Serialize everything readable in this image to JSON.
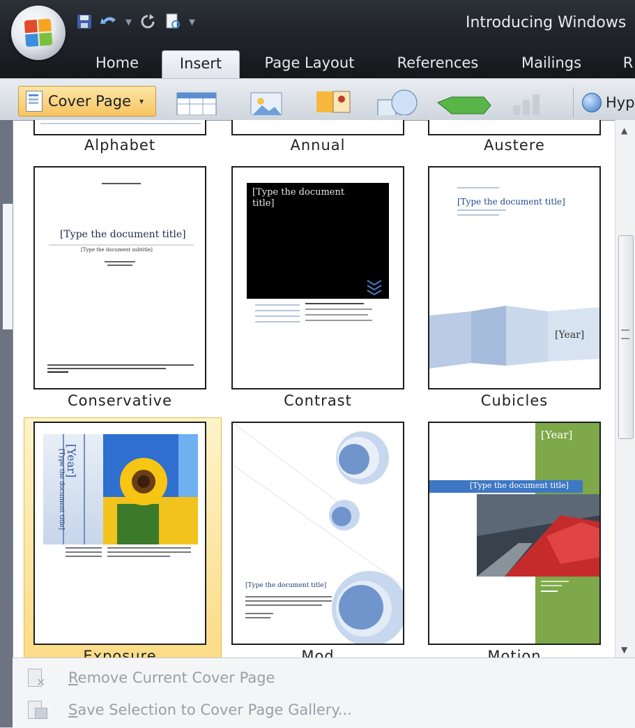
{
  "window": {
    "title": "Introducing Windows"
  },
  "ribbon": {
    "tabs": [
      "Home",
      "Insert",
      "Page Layout",
      "References",
      "Mailings",
      "R"
    ],
    "active_tab": "Insert",
    "cover_page_label": "Cover Page",
    "hyperlink_label": "Hyp"
  },
  "gallery": {
    "items": [
      {
        "label": "Alphabet"
      },
      {
        "label": "Annual"
      },
      {
        "label": "Austere"
      },
      {
        "label": "Conservative",
        "title": "[Type the document title]",
        "subtitle": "[Type the document subtitle]"
      },
      {
        "label": "Contrast",
        "title": "[Type the document title]"
      },
      {
        "label": "Cubicles",
        "title": "[Type the document title]",
        "year": "[Year]"
      },
      {
        "label": "Exposure",
        "title": "[Type the document title]",
        "year": "[Year]"
      },
      {
        "label": "Mod",
        "title": "[Type the document title]"
      },
      {
        "label": "Motion",
        "title": "[Type the document title]",
        "year": "[Year]"
      }
    ]
  },
  "menu": {
    "remove": {
      "underline": "R",
      "rest": "emove Current Cover Page"
    },
    "save": {
      "underline": "S",
      "rest": "ave Selection to Cover Page Gallery..."
    }
  },
  "colors": {
    "accent_highlight": "#fbdc86",
    "motion_green": "#7ea84a",
    "mod_blue": "#6f95cc"
  }
}
